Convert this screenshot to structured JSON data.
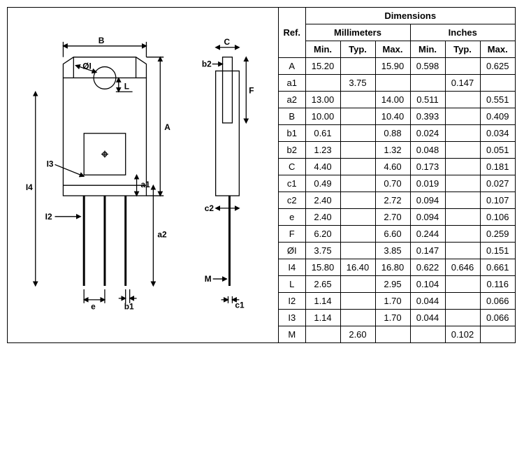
{
  "headers": {
    "dimensions": "Dimensions",
    "ref": "Ref.",
    "millimeters": "Millimeters",
    "inches": "Inches",
    "min": "Min.",
    "typ": "Typ.",
    "max": "Max."
  },
  "diagram_labels": {
    "B": "B",
    "OI": "ØI",
    "L": "L",
    "A": "A",
    "I4": "I4",
    "I3": "I3",
    "I2": "I2",
    "a1": "a1",
    "a2": "a2",
    "e": "e",
    "b1": "b1",
    "C": "C",
    "b2": "b2",
    "F": "F",
    "c2": "c2",
    "M": "M",
    "c1": "c1"
  },
  "rows": [
    {
      "ref": "A",
      "mm_min": "15.20",
      "mm_typ": "",
      "mm_max": "15.90",
      "in_min": "0.598",
      "in_typ": "",
      "in_max": "0.625"
    },
    {
      "ref": "a1",
      "mm_min": "",
      "mm_typ": "3.75",
      "mm_max": "",
      "in_min": "",
      "in_typ": "0.147",
      "in_max": ""
    },
    {
      "ref": "a2",
      "mm_min": "13.00",
      "mm_typ": "",
      "mm_max": "14.00",
      "in_min": "0.511",
      "in_typ": "",
      "in_max": "0.551"
    },
    {
      "ref": "B",
      "mm_min": "10.00",
      "mm_typ": "",
      "mm_max": "10.40",
      "in_min": "0.393",
      "in_typ": "",
      "in_max": "0.409"
    },
    {
      "ref": "b1",
      "mm_min": "0.61",
      "mm_typ": "",
      "mm_max": "0.88",
      "in_min": "0.024",
      "in_typ": "",
      "in_max": "0.034"
    },
    {
      "ref": "b2",
      "mm_min": "1.23",
      "mm_typ": "",
      "mm_max": "1.32",
      "in_min": "0.048",
      "in_typ": "",
      "in_max": "0.051"
    },
    {
      "ref": "C",
      "mm_min": "4.40",
      "mm_typ": "",
      "mm_max": "4.60",
      "in_min": "0.173",
      "in_typ": "",
      "in_max": "0.181"
    },
    {
      "ref": "c1",
      "mm_min": "0.49",
      "mm_typ": "",
      "mm_max": "0.70",
      "in_min": "0.019",
      "in_typ": "",
      "in_max": "0.027"
    },
    {
      "ref": "c2",
      "mm_min": "2.40",
      "mm_typ": "",
      "mm_max": "2.72",
      "in_min": "0.094",
      "in_typ": "",
      "in_max": "0.107"
    },
    {
      "ref": "e",
      "mm_min": "2.40",
      "mm_typ": "",
      "mm_max": "2.70",
      "in_min": "0.094",
      "in_typ": "",
      "in_max": "0.106"
    },
    {
      "ref": "F",
      "mm_min": "6.20",
      "mm_typ": "",
      "mm_max": "6.60",
      "in_min": "0.244",
      "in_typ": "",
      "in_max": "0.259"
    },
    {
      "ref": "ØI",
      "mm_min": "3.75",
      "mm_typ": "",
      "mm_max": "3.85",
      "in_min": "0.147",
      "in_typ": "",
      "in_max": "0.151"
    },
    {
      "ref": "I4",
      "mm_min": "15.80",
      "mm_typ": "16.40",
      "mm_max": "16.80",
      "in_min": "0.622",
      "in_typ": "0.646",
      "in_max": "0.661"
    },
    {
      "ref": "L",
      "mm_min": "2.65",
      "mm_typ": "",
      "mm_max": "2.95",
      "in_min": "0.104",
      "in_typ": "",
      "in_max": "0.116"
    },
    {
      "ref": "I2",
      "mm_min": "1.14",
      "mm_typ": "",
      "mm_max": "1.70",
      "in_min": "0.044",
      "in_typ": "",
      "in_max": "0.066"
    },
    {
      "ref": "I3",
      "mm_min": "1.14",
      "mm_typ": "",
      "mm_max": "1.70",
      "in_min": "0.044",
      "in_typ": "",
      "in_max": "0.066"
    },
    {
      "ref": "M",
      "mm_min": "",
      "mm_typ": "2.60",
      "mm_max": "",
      "in_min": "",
      "in_typ": "0.102",
      "in_max": ""
    }
  ]
}
